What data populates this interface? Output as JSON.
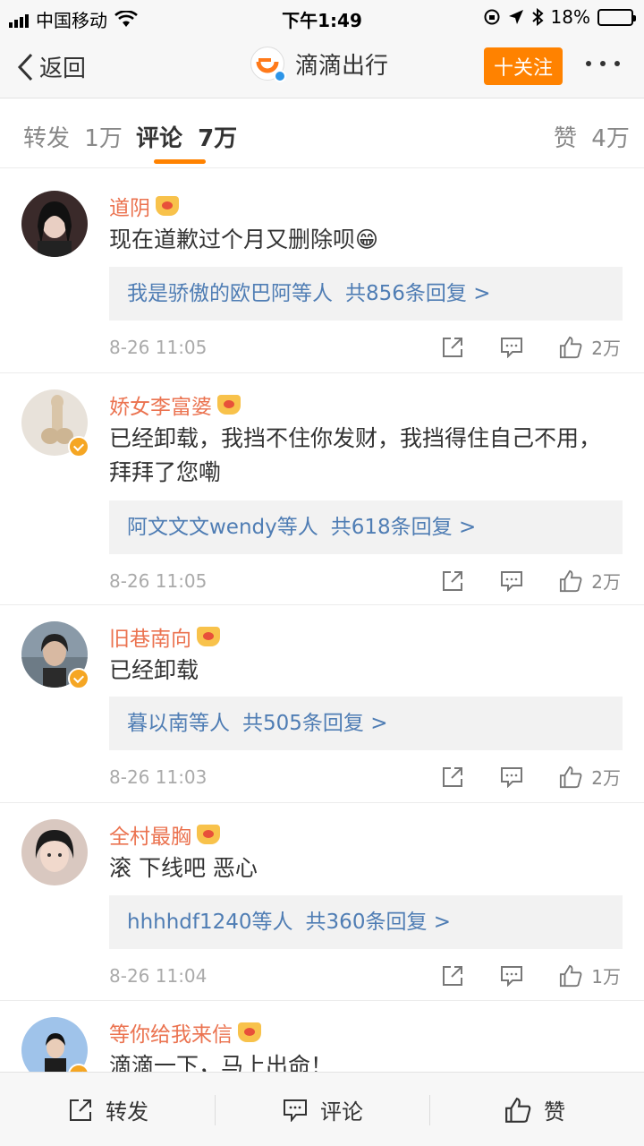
{
  "status_bar": {
    "carrier": "中国移动",
    "time": "下午1:49",
    "battery_percent": "18%",
    "battery_level": 0.18
  },
  "nav": {
    "back_label": "返回",
    "title": "滴滴出行",
    "follow_label": "十关注",
    "accent_color": "#ff8200"
  },
  "tabs": {
    "repost_label": "转发",
    "repost_count": "1万",
    "comment_label": "评论",
    "comment_count": "7万",
    "like_label": "赞",
    "like_count": "4万"
  },
  "comments": [
    {
      "username": "道阴",
      "text": "现在道歉过个月又删除呗😁",
      "reply_users": "我是骄傲的欧巴阿等人",
      "reply_count": "共856条回复 >",
      "time": "8-26 11:05",
      "likes": "2万"
    },
    {
      "username": "娇女李富婆",
      "text": "已经卸载，我挡不住你发财，我挡得住自己不用，拜拜了您嘞",
      "reply_users": "阿文文文wendy等人",
      "reply_count": "共618条回复 >",
      "time": "8-26 11:05",
      "likes": "2万"
    },
    {
      "username": "旧巷南向",
      "text": "已经卸载",
      "reply_users": "暮以南等人",
      "reply_count": "共505条回复 >",
      "time": "8-26 11:03",
      "likes": "2万"
    },
    {
      "username": "全村最胸",
      "text": "滚 下线吧 恶心",
      "reply_users": "hhhhdf1240等人",
      "reply_count": "共360条回复 >",
      "time": "8-26 11:04",
      "likes": "1万"
    },
    {
      "username": "等你给我来信",
      "text": "滴滴一下，马上出命！"
    }
  ],
  "toolbar": {
    "repost_label": "转发",
    "comment_label": "评论",
    "like_label": "赞"
  }
}
